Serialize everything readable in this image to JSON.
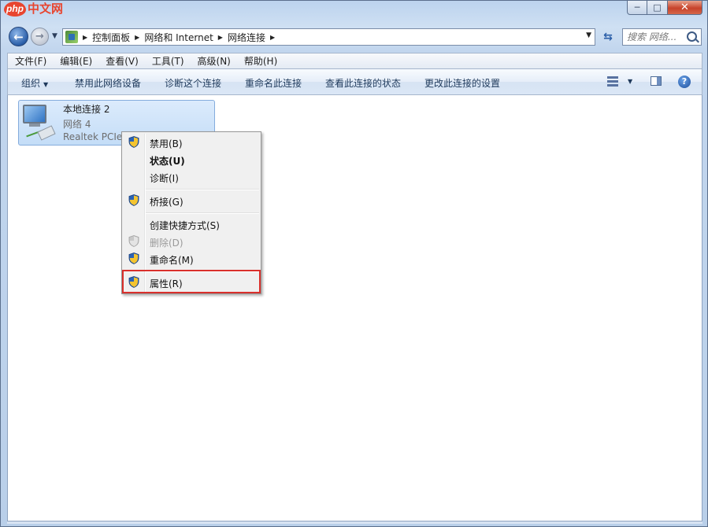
{
  "watermark": {
    "php": "php",
    "cn": "中文网"
  },
  "window": {
    "controls": {
      "minimize": "─",
      "maximize": "□",
      "close": "✕"
    }
  },
  "nav": {
    "breadcrumb": [
      "控制面板",
      "网络和 Internet",
      "网络连接"
    ],
    "search_placeholder": "搜索 网络..."
  },
  "menubar": [
    "文件(F)",
    "编辑(E)",
    "查看(V)",
    "工具(T)",
    "高级(N)",
    "帮助(H)"
  ],
  "commandbar": {
    "organize": "组织",
    "disable": "禁用此网络设备",
    "diagnose": "诊断这个连接",
    "rename": "重命名此连接",
    "view_status": "查看此连接的状态",
    "change_settings": "更改此连接的设置",
    "help": "?"
  },
  "connection": {
    "name": "本地连接 2",
    "network": "网络  4",
    "adapter": "Realtek PCIe"
  },
  "context_menu": {
    "items": [
      {
        "label": "禁用(B)",
        "shield": true
      },
      {
        "label": "状态(U)",
        "bold": true
      },
      {
        "label": "诊断(I)"
      },
      {
        "label": "桥接(G)",
        "shield": true
      },
      {
        "label": "创建快捷方式(S)"
      },
      {
        "label": "删除(D)",
        "shield": true,
        "disabled": true
      },
      {
        "label": "重命名(M)",
        "shield": true
      },
      {
        "label": "属性(R)",
        "shield": true,
        "highlighted": true
      }
    ]
  },
  "colors": {
    "highlight_box": "#d9302c",
    "selection": "#c4ddf7"
  }
}
